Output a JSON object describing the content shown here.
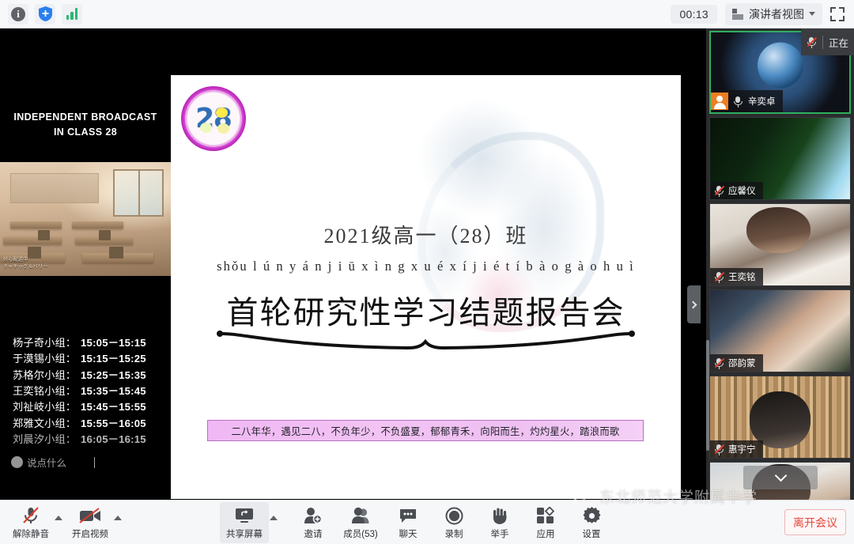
{
  "topbar": {
    "icons": [
      {
        "name": "info-icon",
        "glyph": "i"
      },
      {
        "name": "security-shield-icon",
        "glyph": "+"
      },
      {
        "name": "network-signal-icon",
        "glyph": "bars"
      }
    ],
    "timer": "00:13",
    "view_mode": "演讲者视图",
    "fullscreen_label": "全屏"
  },
  "stage": {
    "broadcast_title_line1": "INDEPENDENT BROADCAST",
    "broadcast_title_line2": "IN CLASS 28",
    "classroom_caption_line1": "好⼼配送中",
    "classroom_caption_line2": "チャキッグルバリー",
    "schedule": [
      {
        "group": "杨子奇小组：",
        "time": "15:05－15:15"
      },
      {
        "group": "于漠锡小组：",
        "time": "15:15－15:25"
      },
      {
        "group": "苏格尔小组：",
        "time": "15:25－15:35"
      },
      {
        "group": "王奕铭小组：",
        "time": "15:35－15:45"
      },
      {
        "group": "刘祉岐小组：",
        "time": "15:45－15:55"
      },
      {
        "group": "郑雅文小组：",
        "time": "15:55－16:05"
      },
      {
        "group": "刘晨汐小组：",
        "time": "16:05－16:15"
      }
    ],
    "chat_overlay_placeholder": "说点什么",
    "collapse_handle": "收起"
  },
  "slide": {
    "logo_number": "28",
    "year_line": "2021级高一（28）班",
    "pinyin": "shǒu l ú n y á n j i ū x ì n g x u é x í j i é t í b à o g à o h u ì",
    "title": "首轮研究性学习结题报告会",
    "banner": "二八年华，遇见二八，不负年少，不负盛夏，郁郁青禾，向阳而生，灼灼星火，踏浪而歌"
  },
  "participant_strip": {
    "status_overlay": "正在",
    "participants": [
      {
        "name": "辛奕卓",
        "muted": true,
        "active_speaker": true,
        "has_video": true,
        "avatar": "orange-person-avatar"
      },
      {
        "name": "应馨仪",
        "muted": true,
        "active_speaker": false,
        "has_video": true
      },
      {
        "name": "王奕铭",
        "muted": true,
        "active_speaker": false,
        "has_video": true
      },
      {
        "name": "邵韵蒙",
        "muted": true,
        "active_speaker": false,
        "has_video": true
      },
      {
        "name": "惠宇宁",
        "muted": true,
        "active_speaker": false,
        "has_video": true
      },
      {
        "name": "",
        "muted": false,
        "active_speaker": false,
        "has_video": true
      }
    ],
    "scroll_down_label": "向下滚动"
  },
  "toolbar": {
    "audio": {
      "label": "解除静音",
      "icon": "microphone-muted-icon"
    },
    "video": {
      "label": "开启视频",
      "icon": "camera-off-icon"
    },
    "share": {
      "label": "共享屏幕",
      "icon": "share-screen-icon"
    },
    "invite": {
      "label": "邀请",
      "icon": "person-add-icon"
    },
    "participants": {
      "label": "成员(53)",
      "icon": "people-icon"
    },
    "chat": {
      "label": "聊天",
      "icon": "chat-bubble-icon"
    },
    "record": {
      "label": "录制",
      "icon": "record-circle-icon"
    },
    "raise_hand": {
      "label": "举手",
      "icon": "raised-hand-icon"
    },
    "apps": {
      "label": "应用",
      "icon": "apps-grid-icon"
    },
    "settings": {
      "label": "设置",
      "icon": "gear-icon"
    },
    "leave": {
      "label": "离开会议"
    }
  },
  "watermark": {
    "text": "东北师范大学附属中学",
    "icon": "wechat-icon"
  },
  "colors": {
    "accent_green": "#2faf5e",
    "leave_red": "#e8453c",
    "topbar_bg": "#f7f8fa",
    "stage_bg": "#000000",
    "strip_bg": "#2b2c2e"
  }
}
